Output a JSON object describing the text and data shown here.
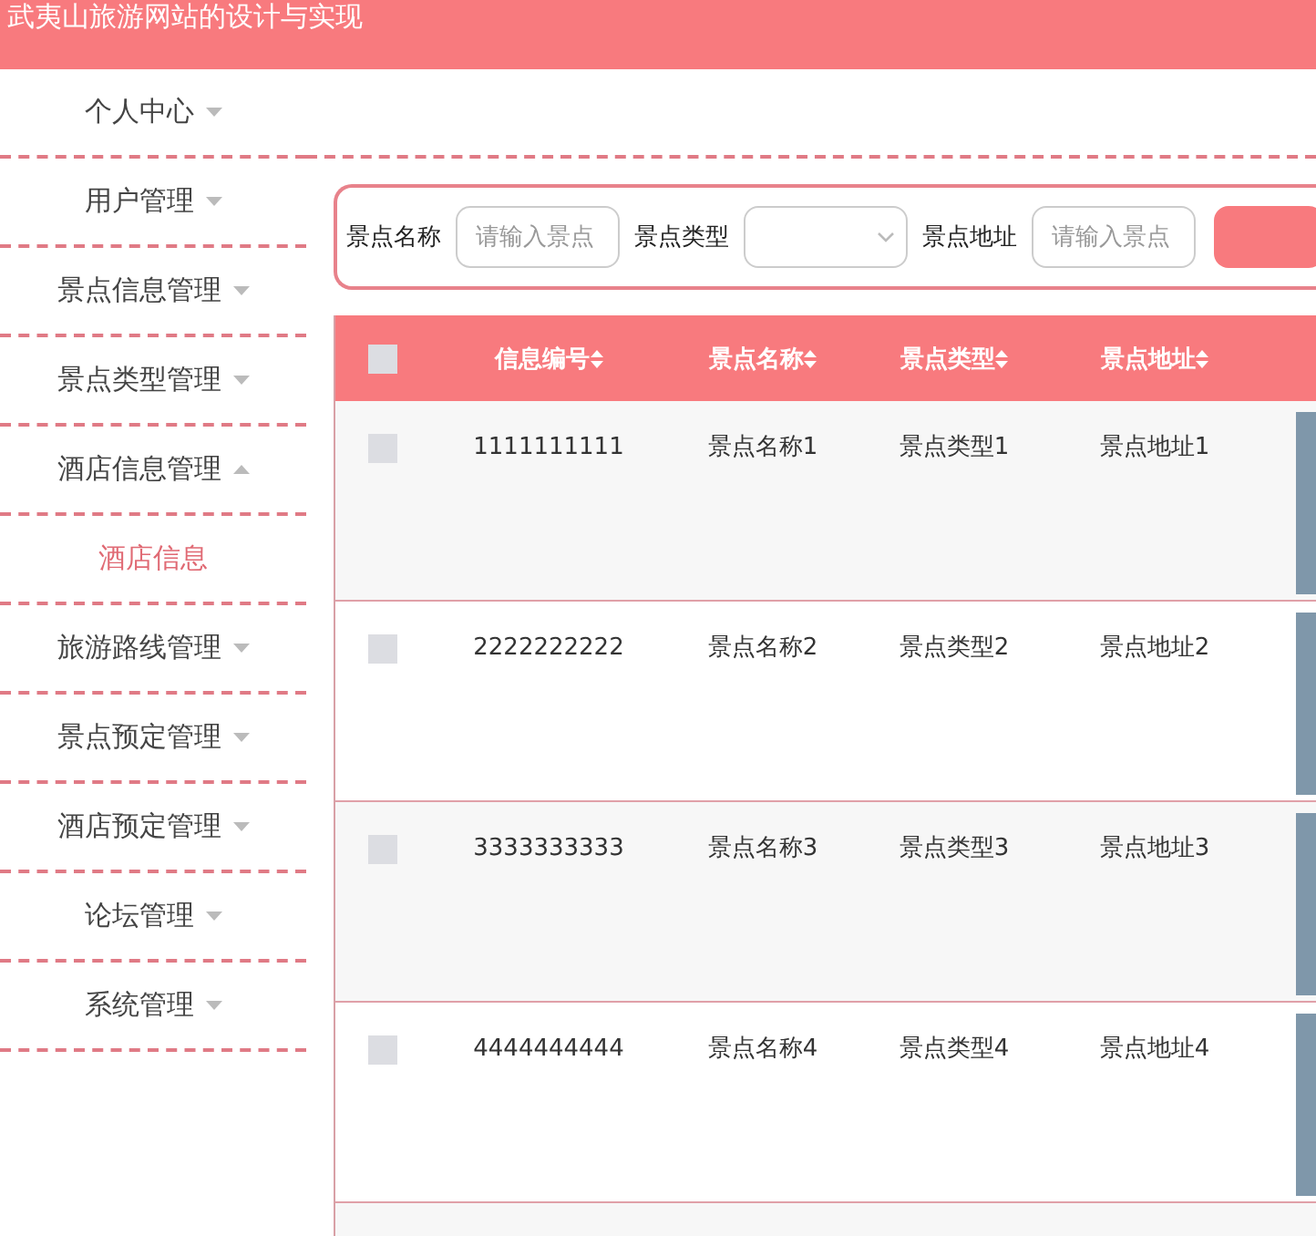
{
  "header": {
    "title": "武夷山旅游网站的设计与实现"
  },
  "sidebar": {
    "items": [
      {
        "label": "个人中心",
        "expanded": false
      },
      {
        "label": "用户管理",
        "expanded": false
      },
      {
        "label": "景点信息管理",
        "expanded": false
      },
      {
        "label": "景点类型管理",
        "expanded": false
      },
      {
        "label": "酒店信息管理",
        "expanded": true,
        "children": [
          {
            "label": "酒店信息",
            "selected": true
          }
        ]
      },
      {
        "label": "旅游路线管理",
        "expanded": false
      },
      {
        "label": "景点预定管理",
        "expanded": false
      },
      {
        "label": "酒店预定管理",
        "expanded": false
      },
      {
        "label": "论坛管理",
        "expanded": false
      },
      {
        "label": "系统管理",
        "expanded": false
      }
    ]
  },
  "search": {
    "fields": [
      {
        "kind": "input",
        "label": "景点名称",
        "placeholder": "请输入景点"
      },
      {
        "kind": "select",
        "label": "景点类型"
      },
      {
        "kind": "input",
        "label": "景点地址",
        "placeholder": "请输入景点"
      }
    ]
  },
  "table": {
    "all_checked": false,
    "columns": [
      "信息编号",
      "景点名称",
      "景点类型",
      "景点地址"
    ],
    "rows": [
      {
        "checked": false,
        "cells": [
          "1111111111",
          "景点名称1",
          "景点类型1",
          "景点地址1"
        ]
      },
      {
        "checked": false,
        "cells": [
          "2222222222",
          "景点名称2",
          "景点类型2",
          "景点地址2"
        ]
      },
      {
        "checked": false,
        "cells": [
          "3333333333",
          "景点名称3",
          "景点类型3",
          "景点地址3"
        ]
      },
      {
        "checked": false,
        "cells": [
          "4444444444",
          "景点名称4",
          "景点类型4",
          "景点地址4"
        ]
      }
    ]
  }
}
